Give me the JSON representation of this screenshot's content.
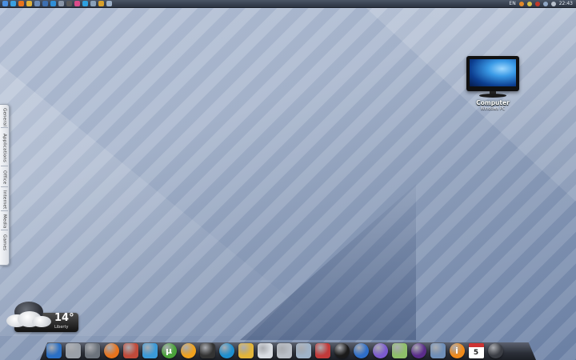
{
  "topbar": {
    "language": "EN",
    "clock": "22:43",
    "icon_names": [
      "start-icon",
      "ie-icon",
      "firefox-icon",
      "folder-icon",
      "dock-icon",
      "monitor-icon",
      "ie-icon",
      "window-icon",
      "media-icon",
      "color-icon",
      "skype-icon",
      "tools-icon",
      "paint-icon",
      "desktop-icon"
    ],
    "tray_icons": [
      "network-icon",
      "volume-icon",
      "user-icon",
      "security-icon",
      "shield-icon",
      "arrows-icon",
      "speaker-icon"
    ]
  },
  "sidebar": {
    "tabs": [
      "General",
      "Applications",
      "Office",
      "Internet",
      "Media",
      "Games"
    ]
  },
  "desktop_icon": {
    "label": "Computer",
    "sublabel": "Windows PC"
  },
  "weather": {
    "temperature": "14°",
    "city": "Liberty"
  },
  "dock": {
    "items": [
      {
        "name": "monitor-icon",
        "color": "#2a6fc4",
        "glyph": ""
      },
      {
        "name": "pc-tower-icon",
        "color": "#9aa0a8",
        "glyph": ""
      },
      {
        "name": "drive-icon",
        "color": "#6c737c",
        "glyph": ""
      },
      {
        "name": "firefox-icon",
        "color": "#e8731c",
        "glyph": ""
      },
      {
        "name": "photo-viewer-icon",
        "color": "#c04a3a",
        "glyph": ""
      },
      {
        "name": "messenger-icon",
        "color": "#3b9ad8",
        "glyph": ""
      },
      {
        "name": "utorrent-icon",
        "color": "#4aa33a",
        "glyph": "µ"
      },
      {
        "name": "media-icon",
        "color": "#f0a21e",
        "glyph": ""
      },
      {
        "name": "clapper-icon",
        "color": "#333333",
        "glyph": ""
      },
      {
        "name": "play-icon",
        "color": "#1d8fcf",
        "glyph": ""
      },
      {
        "name": "mail-icon",
        "color": "#e2b53a",
        "glyph": ""
      },
      {
        "name": "phone-icon",
        "color": "#d8dce2",
        "glyph": ""
      },
      {
        "name": "disk-utility-icon",
        "color": "#b9bec6",
        "glyph": ""
      },
      {
        "name": "folder-icon",
        "color": "#9fb3c8",
        "glyph": ""
      },
      {
        "name": "save-icon",
        "color": "#c23a3a",
        "glyph": ""
      },
      {
        "name": "nero-icon",
        "color": "#1a1a1a",
        "glyph": ""
      },
      {
        "name": "winamp-icon",
        "color": "#2e6ec8",
        "glyph": ""
      },
      {
        "name": "dvd-icon",
        "color": "#7c5bd0",
        "glyph": ""
      },
      {
        "name": "maps-icon",
        "color": "#8fbf6a",
        "glyph": ""
      },
      {
        "name": "globe-icon",
        "color": "#5a2c8a",
        "glyph": ""
      },
      {
        "name": "tools-icon",
        "color": "#6f8fb8",
        "glyph": ""
      },
      {
        "name": "info-icon",
        "color": "#f08a1a",
        "glyph": "i"
      },
      {
        "name": "calendar-icon",
        "color": "#ffffff",
        "glyph": "5"
      },
      {
        "name": "clock-icon",
        "color": "#3a3d44",
        "glyph": ""
      }
    ]
  }
}
